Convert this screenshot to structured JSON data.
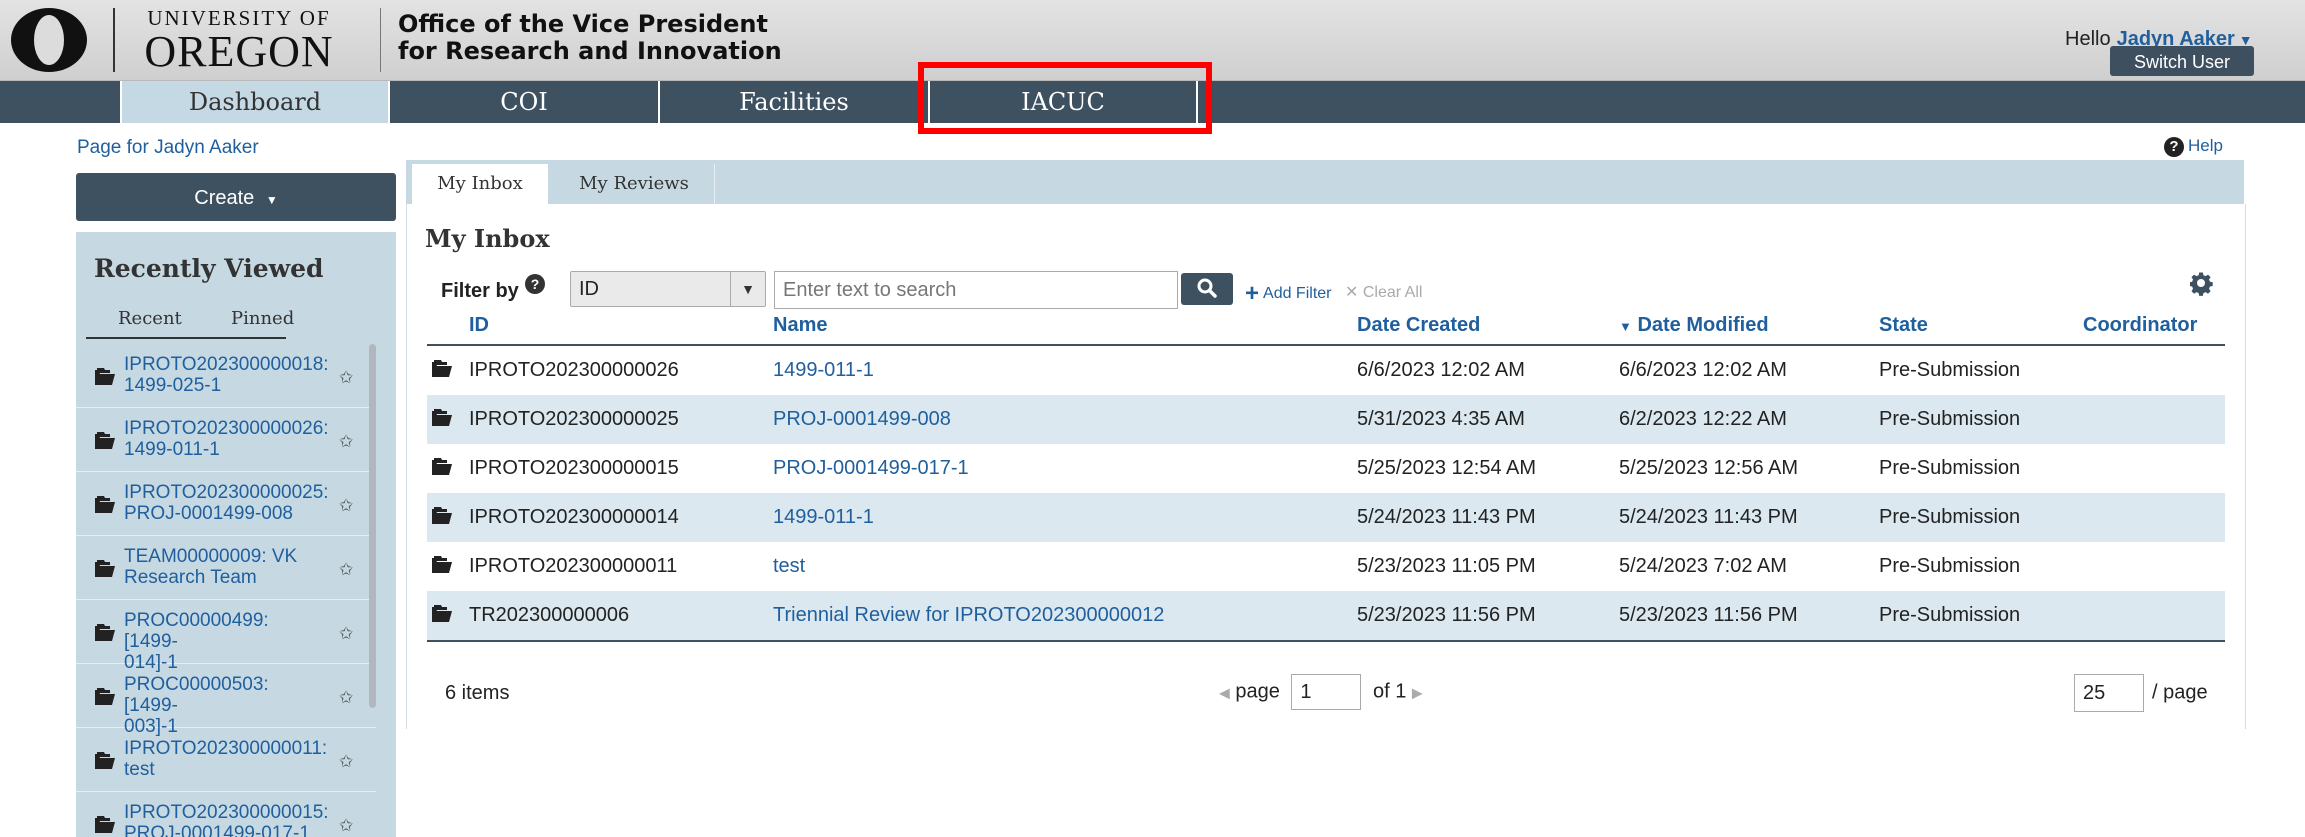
{
  "header": {
    "university_top": "UNIVERSITY OF",
    "university_bottom": "OREGON",
    "office_line1": "Office of the Vice President",
    "office_line2": "for Research and Innovation",
    "hello": "Hello",
    "user_name": "Jadyn Aaker",
    "switch_user": "Switch User"
  },
  "nav": {
    "tabs": [
      "Dashboard",
      "COI",
      "Facilities",
      "IACUC"
    ],
    "active": "Dashboard",
    "highlighted": "IACUC",
    "highlight_color": "#ff0000"
  },
  "page": {
    "page_for": "Page for Jadyn Aaker",
    "help": "Help"
  },
  "left": {
    "create_label": "Create",
    "recently_viewed_title": "Recently Viewed",
    "tabs": [
      "Recent",
      "Pinned"
    ],
    "items": [
      {
        "line1": "IPROTO202300000018:",
        "line2": "1499-025-1"
      },
      {
        "line1": "IPROTO202300000026:",
        "line2": "1499-011-1"
      },
      {
        "line1": "IPROTO202300000025:",
        "line2": "PROJ-0001499-008"
      },
      {
        "line1": "TEAM00000009: VK",
        "line2": "Research Team"
      },
      {
        "line1": "PROC00000499: [1499-",
        "line2": "014]-1"
      },
      {
        "line1": "PROC00000503: [1499-",
        "line2": "003]-1"
      },
      {
        "line1": "IPROTO202300000011:",
        "line2": "test"
      },
      {
        "line1": "IPROTO202300000015:",
        "line2": "PROJ-0001499-017-1"
      }
    ]
  },
  "main": {
    "tabs": [
      "My Inbox",
      "My Reviews"
    ],
    "inbox_title": "My Inbox",
    "filter_by": "Filter by",
    "filter_value": "ID",
    "search_placeholder": "Enter text to search",
    "add_filter": "Add Filter",
    "clear_all": "Clear All",
    "columns": [
      "ID",
      "Name",
      "Date Created",
      "Date Modified",
      "State",
      "Coordinator"
    ],
    "sorted_column": "Date Modified",
    "rows": [
      {
        "id": "IPROTO202300000026",
        "name": "1499-011-1",
        "created": "6/6/2023 12:02 AM",
        "modified": "6/6/2023 12:02 AM",
        "state": "Pre-Submission",
        "coordinator": ""
      },
      {
        "id": "IPROTO202300000025",
        "name": "PROJ-0001499-008",
        "created": "5/31/2023 4:35 AM",
        "modified": "6/2/2023 12:22 AM",
        "state": "Pre-Submission",
        "coordinator": ""
      },
      {
        "id": "IPROTO202300000015",
        "name": "PROJ-0001499-017-1",
        "created": "5/25/2023 12:54 AM",
        "modified": "5/25/2023 12:56 AM",
        "state": "Pre-Submission",
        "coordinator": ""
      },
      {
        "id": "IPROTO202300000014",
        "name": "1499-011-1",
        "created": "5/24/2023 11:43 PM",
        "modified": "5/24/2023 11:43 PM",
        "state": "Pre-Submission",
        "coordinator": ""
      },
      {
        "id": "IPROTO202300000011",
        "name": "test",
        "created": "5/23/2023 11:05 PM",
        "modified": "5/24/2023 7:02 AM",
        "state": "Pre-Submission",
        "coordinator": ""
      },
      {
        "id": "TR202300000006",
        "name": "Triennial Review for IPROTO202300000012",
        "created": "5/23/2023 11:56 PM",
        "modified": "5/23/2023 11:56 PM",
        "state": "Pre-Submission",
        "coordinator": ""
      }
    ],
    "items_count": "6 items",
    "page_label": "page",
    "page_value": "1",
    "of_label": "of 1",
    "per_page_value": "25",
    "per_page_label": "/ page"
  },
  "colors": {
    "nav_bg": "#3e5161",
    "link": "#1f5f9e",
    "panel_bg": "#c6d9e3",
    "row_alt": "#dbe8ef"
  }
}
